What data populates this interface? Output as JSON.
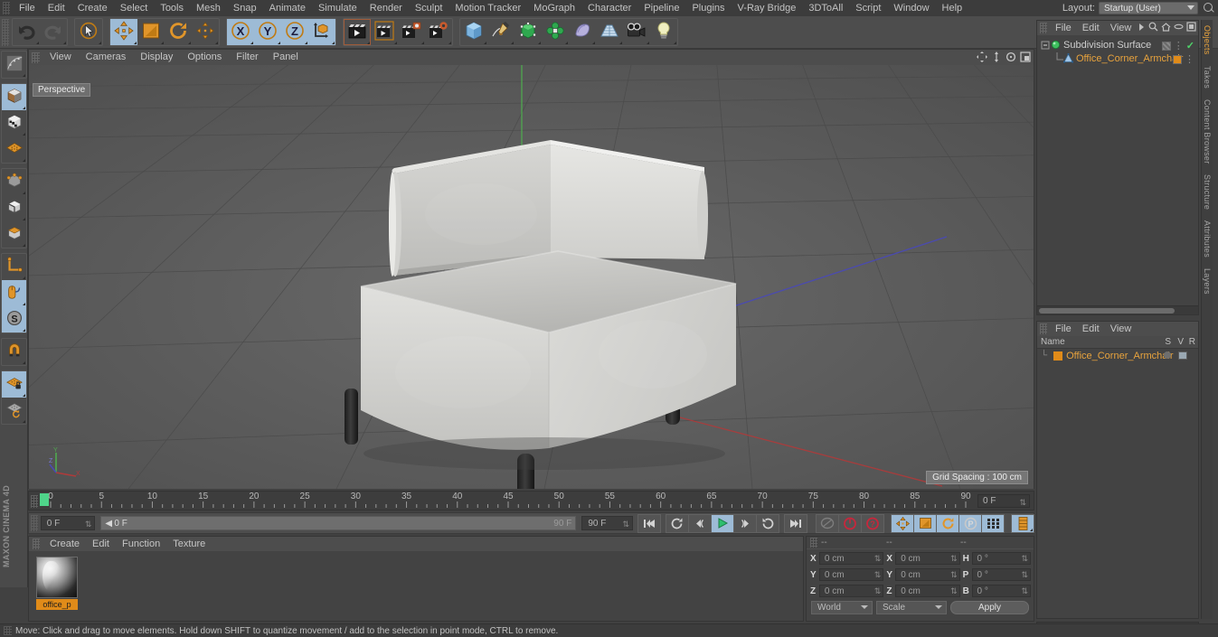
{
  "app": {
    "name": "MAXON CINEMA 4D"
  },
  "menubar": {
    "items": [
      "File",
      "Edit",
      "Create",
      "Select",
      "Tools",
      "Mesh",
      "Snap",
      "Animate",
      "Simulate",
      "Render",
      "Sculpt",
      "Motion Tracker",
      "MoGraph",
      "Character",
      "Pipeline",
      "Plugins",
      "V-Ray Bridge",
      "3DToAll",
      "Script",
      "Window",
      "Help"
    ],
    "layout_label": "Layout:",
    "layout_value": "Startup (User)",
    "search_icon": "search-icon"
  },
  "toolbar": {
    "groups": [
      {
        "name": "history",
        "buttons": [
          {
            "name": "undo-button",
            "icon": "undo-arrow-icon",
            "state": "normal"
          },
          {
            "name": "redo-button",
            "icon": "redo-arrow-icon",
            "state": "disabled"
          }
        ]
      },
      {
        "name": "selection",
        "buttons": [
          {
            "name": "live-selection-tool",
            "icon": "cursor-circle-icon",
            "state": "normal"
          }
        ]
      },
      {
        "name": "transform",
        "buttons": [
          {
            "name": "move-tool",
            "icon": "move-arrows-icon",
            "state": "active"
          },
          {
            "name": "scale-tool",
            "icon": "scale-box-icon",
            "state": "normal"
          },
          {
            "name": "rotate-tool",
            "icon": "rotate-circle-icon",
            "state": "normal"
          },
          {
            "name": "transform-tool",
            "icon": "plus-cross-icon",
            "state": "normal"
          }
        ]
      },
      {
        "name": "axis-locks",
        "buttons": [
          {
            "name": "lock-x-axis",
            "icon": "x-axis-icon",
            "state": "active"
          },
          {
            "name": "lock-y-axis",
            "icon": "y-axis-icon",
            "state": "active"
          },
          {
            "name": "lock-z-axis",
            "icon": "z-axis-icon",
            "state": "active"
          },
          {
            "name": "world-object-coordinates",
            "icon": "axis-corner-icon",
            "state": "active"
          }
        ]
      },
      {
        "name": "render",
        "buttons": [
          {
            "name": "render-view-button",
            "icon": "clapper-icon",
            "state": "selected"
          },
          {
            "name": "render-region-button",
            "icon": "clapper-frame-icon",
            "state": "normal"
          },
          {
            "name": "render-to-picture-viewer-button",
            "icon": "clapper-picture-icon",
            "state": "normal"
          },
          {
            "name": "render-settings-button",
            "icon": "clapper-gear-icon",
            "state": "normal"
          }
        ]
      },
      {
        "name": "objects",
        "buttons": [
          {
            "name": "add-cube-button",
            "icon": "cube-icon",
            "state": "normal"
          },
          {
            "name": "add-spline-button",
            "icon": "pen-spline-icon",
            "state": "normal"
          },
          {
            "name": "add-generator-button",
            "icon": "green-cube-icon",
            "state": "normal"
          },
          {
            "name": "add-deformer-button",
            "icon": "green-deformer-icon",
            "state": "normal"
          },
          {
            "name": "add-scene-object-button",
            "icon": "environment-icon",
            "state": "normal"
          },
          {
            "name": "add-floor-button",
            "icon": "floor-grid-icon",
            "state": "normal"
          },
          {
            "name": "add-camera-button",
            "icon": "camera-icon",
            "state": "normal"
          },
          {
            "name": "add-light-button",
            "icon": "lightbulb-icon",
            "state": "normal"
          }
        ]
      }
    ]
  },
  "left_toolbar": {
    "groups": [
      {
        "buttons": [
          {
            "name": "make-editable-button",
            "icon": "make-editable-icon",
            "state": "normal"
          }
        ]
      },
      {
        "buttons": [
          {
            "name": "model-mode-button",
            "icon": "model-cube-icon",
            "state": "active"
          },
          {
            "name": "texture-mode-button",
            "icon": "texture-cube-icon",
            "state": "normal"
          },
          {
            "name": "workplane-mode-button",
            "icon": "workplane-icon",
            "state": "normal"
          }
        ]
      },
      {
        "buttons": [
          {
            "name": "point-mode-button",
            "icon": "points-cube-icon",
            "state": "normal"
          },
          {
            "name": "edge-mode-button",
            "icon": "edge-cube-icon",
            "state": "normal"
          },
          {
            "name": "polygon-mode-button",
            "icon": "polygon-cube-icon",
            "state": "normal"
          }
        ]
      },
      {
        "buttons": [
          {
            "name": "enable-axis-modification-button",
            "icon": "axis-l-icon",
            "state": "normal"
          },
          {
            "name": "viewport-solo-button",
            "icon": "mouse-icon",
            "state": "active"
          },
          {
            "name": "soft-selection-button",
            "icon": "s-circle-icon",
            "state": "active"
          }
        ]
      },
      {
        "buttons": [
          {
            "name": "snap-magnet-button",
            "icon": "magnet-icon",
            "state": "normal"
          }
        ]
      },
      {
        "buttons": [
          {
            "name": "lock-workplane-button",
            "icon": "grid-lock-icon",
            "state": "active"
          },
          {
            "name": "planar-workplane-button",
            "icon": "grid-rotate-icon",
            "state": "normal"
          }
        ]
      }
    ]
  },
  "viewport": {
    "menus": [
      "View",
      "Cameras",
      "Display",
      "Options",
      "Filter",
      "Panel"
    ],
    "view_label": "Perspective",
    "grid_spacing": "Grid Spacing : 100 cm",
    "corner_icons": [
      "pan-icon",
      "zoom-icon",
      "rotate-icon",
      "maximize-icon"
    ],
    "axis_gizmo": {
      "x": "X",
      "y": "Y",
      "z": "Z"
    }
  },
  "timeline": {
    "ticks": [
      0,
      5,
      10,
      15,
      20,
      25,
      30,
      35,
      40,
      45,
      50,
      55,
      60,
      65,
      70,
      75,
      80,
      85,
      90
    ],
    "start": 0,
    "end": 90,
    "current_frame_value": "0 F",
    "playhead_frame": 0
  },
  "playback": {
    "current_frame": "0 F",
    "range_start": "0 F",
    "range_end": "90 F",
    "end_frame": "90 F",
    "buttons": [
      {
        "name": "go-to-start-button",
        "icon": "skip-start-icon"
      },
      {
        "name": "previous-key-button",
        "icon": "prev-key-icon"
      },
      {
        "name": "step-back-button",
        "icon": "step-back-icon"
      },
      {
        "name": "play-button",
        "icon": "play-icon"
      },
      {
        "name": "step-forward-button",
        "icon": "step-forward-icon"
      },
      {
        "name": "next-key-button",
        "icon": "next-key-icon"
      },
      {
        "name": "go-to-end-button",
        "icon": "skip-end-icon"
      },
      {
        "name": "record-active-objects-button",
        "icon": "record-circle-icon"
      },
      {
        "name": "autokeying-button",
        "icon": "autokey-icon"
      },
      {
        "name": "keyframe-selection-button",
        "icon": "key-question-icon"
      },
      {
        "name": "position-key-button",
        "icon": "move-arrows-icon"
      },
      {
        "name": "scale-key-button",
        "icon": "scale-box-icon"
      },
      {
        "name": "rotation-key-button",
        "icon": "rotate-circle-icon"
      },
      {
        "name": "parameter-key-button",
        "icon": "p-circle-icon"
      },
      {
        "name": "point-level-animation-button",
        "icon": "pla-dots-icon"
      },
      {
        "name": "timeline-toggle-button",
        "icon": "timeline-icon"
      }
    ]
  },
  "material_manager": {
    "menus": [
      "Create",
      "Edit",
      "Function",
      "Texture"
    ],
    "materials": [
      {
        "name": "office_p",
        "icon": "material-sphere-icon"
      }
    ]
  },
  "coordinates": {
    "headers": [
      "--",
      "--",
      "--"
    ],
    "rows": [
      {
        "pos_label": "X",
        "pos_value": "0 cm",
        "size_label": "X",
        "size_value": "0 cm",
        "rot_label": "H",
        "rot_value": "0 °"
      },
      {
        "pos_label": "Y",
        "pos_value": "0 cm",
        "size_label": "Y",
        "size_value": "0 cm",
        "rot_label": "P",
        "rot_value": "0 °"
      },
      {
        "pos_label": "Z",
        "pos_value": "0 cm",
        "size_label": "Z",
        "size_value": "0 cm",
        "rot_label": "B",
        "rot_value": "0 °"
      }
    ],
    "system": "World",
    "mode": "Scale",
    "apply_label": "Apply"
  },
  "object_manager": {
    "menus": [
      "File",
      "Edit",
      "View"
    ],
    "more_icon": "chevron-right-icon",
    "tools": [
      "search-icon",
      "home-icon",
      "ellipse-icon",
      "frame-icon"
    ],
    "objects": [
      {
        "name": "Subdivision Surface",
        "icon": "subdivision-surface-icon",
        "selected": false,
        "enabled": true
      },
      {
        "name": "Office_Corner_Armchair",
        "icon": "polygon-object-icon",
        "selected": true,
        "enabled": true
      }
    ]
  },
  "layer_manager": {
    "menus": [
      "File",
      "Edit",
      "View"
    ],
    "columns": [
      "Name",
      "S",
      "V",
      "R"
    ],
    "rows": [
      {
        "name": "Office_Corner_Armchair",
        "color": "#e08b19"
      }
    ]
  },
  "right_tabs": [
    {
      "label": "Objects",
      "active": true
    },
    {
      "label": "Takes",
      "active": false
    },
    {
      "label": "Content Browser",
      "active": false
    },
    {
      "label": "Structure",
      "active": false
    },
    {
      "label": "Attributes",
      "active": false
    },
    {
      "label": "Layers",
      "active": false
    }
  ],
  "statusbar": {
    "text": "Move: Click and drag to move elements. Hold down SHIFT to quantize movement / add to the selection in point mode, CTRL to remove."
  },
  "colors": {
    "accent_orange": "#e08b19",
    "active_blue": "#9dbbd6",
    "panel_bg": "#434343",
    "toolbar_bg": "#4d4d4d",
    "viewport_bg": "#5a5a5a",
    "axis_x": "#b03a3a",
    "axis_y": "#4faa4f",
    "axis_z": "#4a4ab5",
    "play_green": "#4fd48a"
  }
}
